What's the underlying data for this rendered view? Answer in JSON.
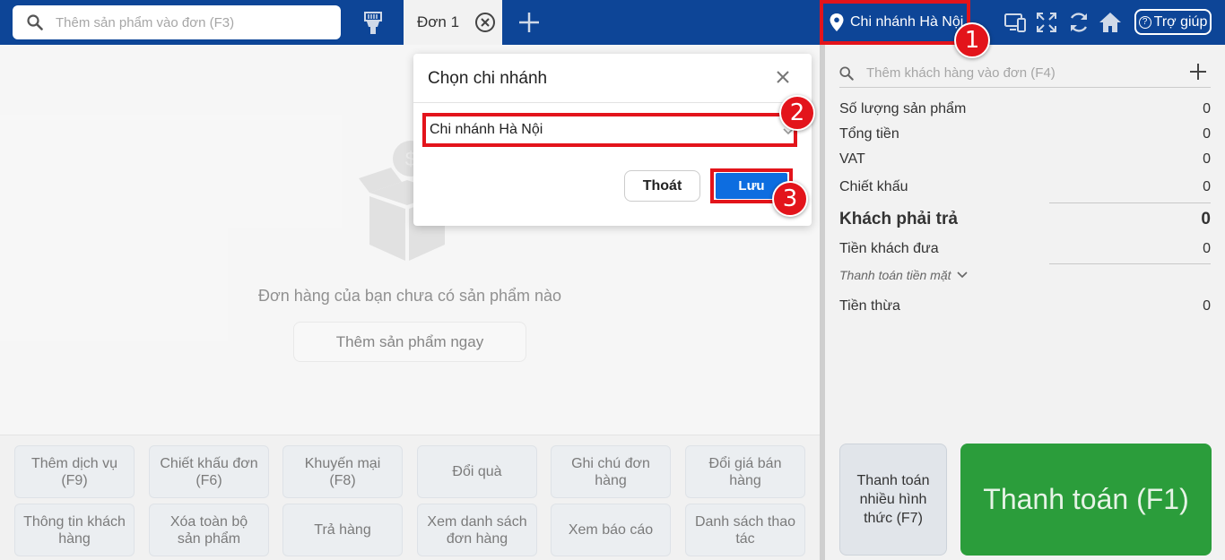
{
  "topbar": {
    "search_placeholder": "Thêm sản phẩm vào đơn (F3)",
    "tab_label": "Đơn 1",
    "branch_label": "Chi nhánh Hà Nội",
    "help_label": "Trợ giúp"
  },
  "main": {
    "empty_message": "Đơn hàng của bạn chưa có sản phẩm nào",
    "add_now_label": "Thêm sản phẩm ngay"
  },
  "actions": [
    "Thêm dịch vụ (F9)",
    "Chiết khấu đơn (F6)",
    "Khuyến mại (F8)",
    "Đổi quà",
    "Ghi chú đơn hàng",
    "Đổi giá bán hàng",
    "Thông tin khách hàng",
    "Xóa toàn bộ sản phẩm",
    "Trả hàng",
    "Xem danh sách đơn hàng",
    "Xem báo cáo",
    "Danh sách thao tác"
  ],
  "summary": {
    "customer_placeholder": "Thêm khách hàng vào đơn (F4)",
    "qty_label": "Số lượng sản phẩm",
    "qty_value": "0",
    "total_label": "Tổng tiền",
    "total_value": "0",
    "vat_label": "VAT",
    "vat_value": "0",
    "discount_label": "Chiết khấu",
    "discount_value": "0",
    "payable_label": "Khách phải trả",
    "payable_value": "0",
    "given_label": "Tiền khách đưa",
    "given_value": "0",
    "pay_mode": "Thanh toán tiền mặt",
    "change_label": "Tiền thừa",
    "change_value": "0",
    "multi_pay_label": "Thanh toán nhiều hình thức (F7)",
    "pay_label": "Thanh toán (F1)"
  },
  "modal": {
    "title": "Chọn chi nhánh",
    "selected_branch": "Chi nhánh Hà Nội",
    "exit_label": "Thoát",
    "save_label": "Lưu"
  },
  "annotations": [
    "1",
    "2",
    "3"
  ],
  "colors": {
    "topbar": "#0d4597",
    "highlight": "#e3141b",
    "save": "#0d6de0",
    "pay": "#2b9d3b"
  }
}
